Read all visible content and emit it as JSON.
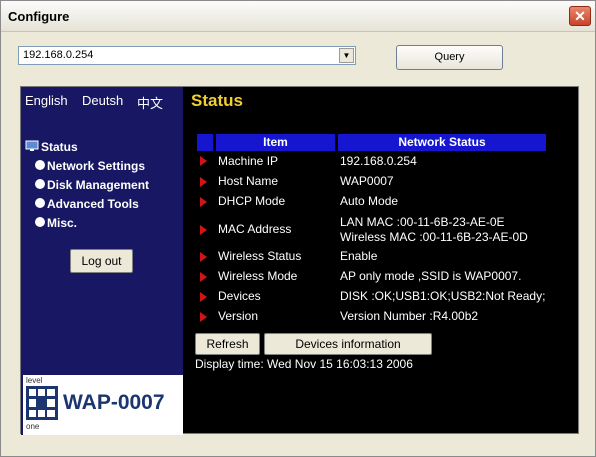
{
  "window": {
    "title": "Configure",
    "close_glyph": "✕"
  },
  "toolbar": {
    "url_value": "192.168.0.254",
    "query_label": "Query"
  },
  "sidebar": {
    "languages": [
      "English",
      "Deutsh",
      "中文"
    ],
    "items": [
      {
        "label": "Status",
        "icon": "monitor-icon"
      },
      {
        "label": "Network Settings",
        "icon": "radio-bullet-icon"
      },
      {
        "label": "Disk Management",
        "icon": "radio-bullet-icon"
      },
      {
        "label": "Advanced Tools",
        "icon": "radio-bullet-icon"
      },
      {
        "label": "Misc.",
        "icon": "radio-bullet-icon"
      }
    ],
    "logout_label": "Log out",
    "logo": {
      "brand_top": "level",
      "brand_bottom": "one",
      "model": "WAP-0007"
    }
  },
  "main": {
    "title": "Status",
    "table": {
      "headers": [
        "Item",
        "Network Status"
      ],
      "rows": [
        {
          "item": "Machine IP",
          "value": "192.168.0.254"
        },
        {
          "item": "Host Name",
          "value": "WAP0007"
        },
        {
          "item": "DHCP Mode",
          "value": "Auto Mode"
        },
        {
          "item": "MAC Address",
          "value": "LAN MAC :00-11-6B-23-AE-0E",
          "value2": "Wireless MAC :00-11-6B-23-AE-0D"
        },
        {
          "item": "Wireless Status",
          "value": "Enable"
        },
        {
          "item": "Wireless Mode",
          "value": "AP only mode ,SSID is WAP0007."
        },
        {
          "item": "Devices",
          "value": "DISK :OK;USB1:OK;USB2:Not Ready;"
        },
        {
          "item": "Version",
          "value": "Version Number :R4.00b2"
        }
      ]
    },
    "buttons": {
      "refresh": "Refresh",
      "devices_info": "Devices information"
    },
    "display_time": "Display time: Wed Nov 15 16:03:13 2006"
  },
  "colors": {
    "sidebar_bg": "#171763",
    "header_bg": "#1616d0",
    "title_yellow": "#f0d030",
    "arrow_red": "#d01515"
  }
}
